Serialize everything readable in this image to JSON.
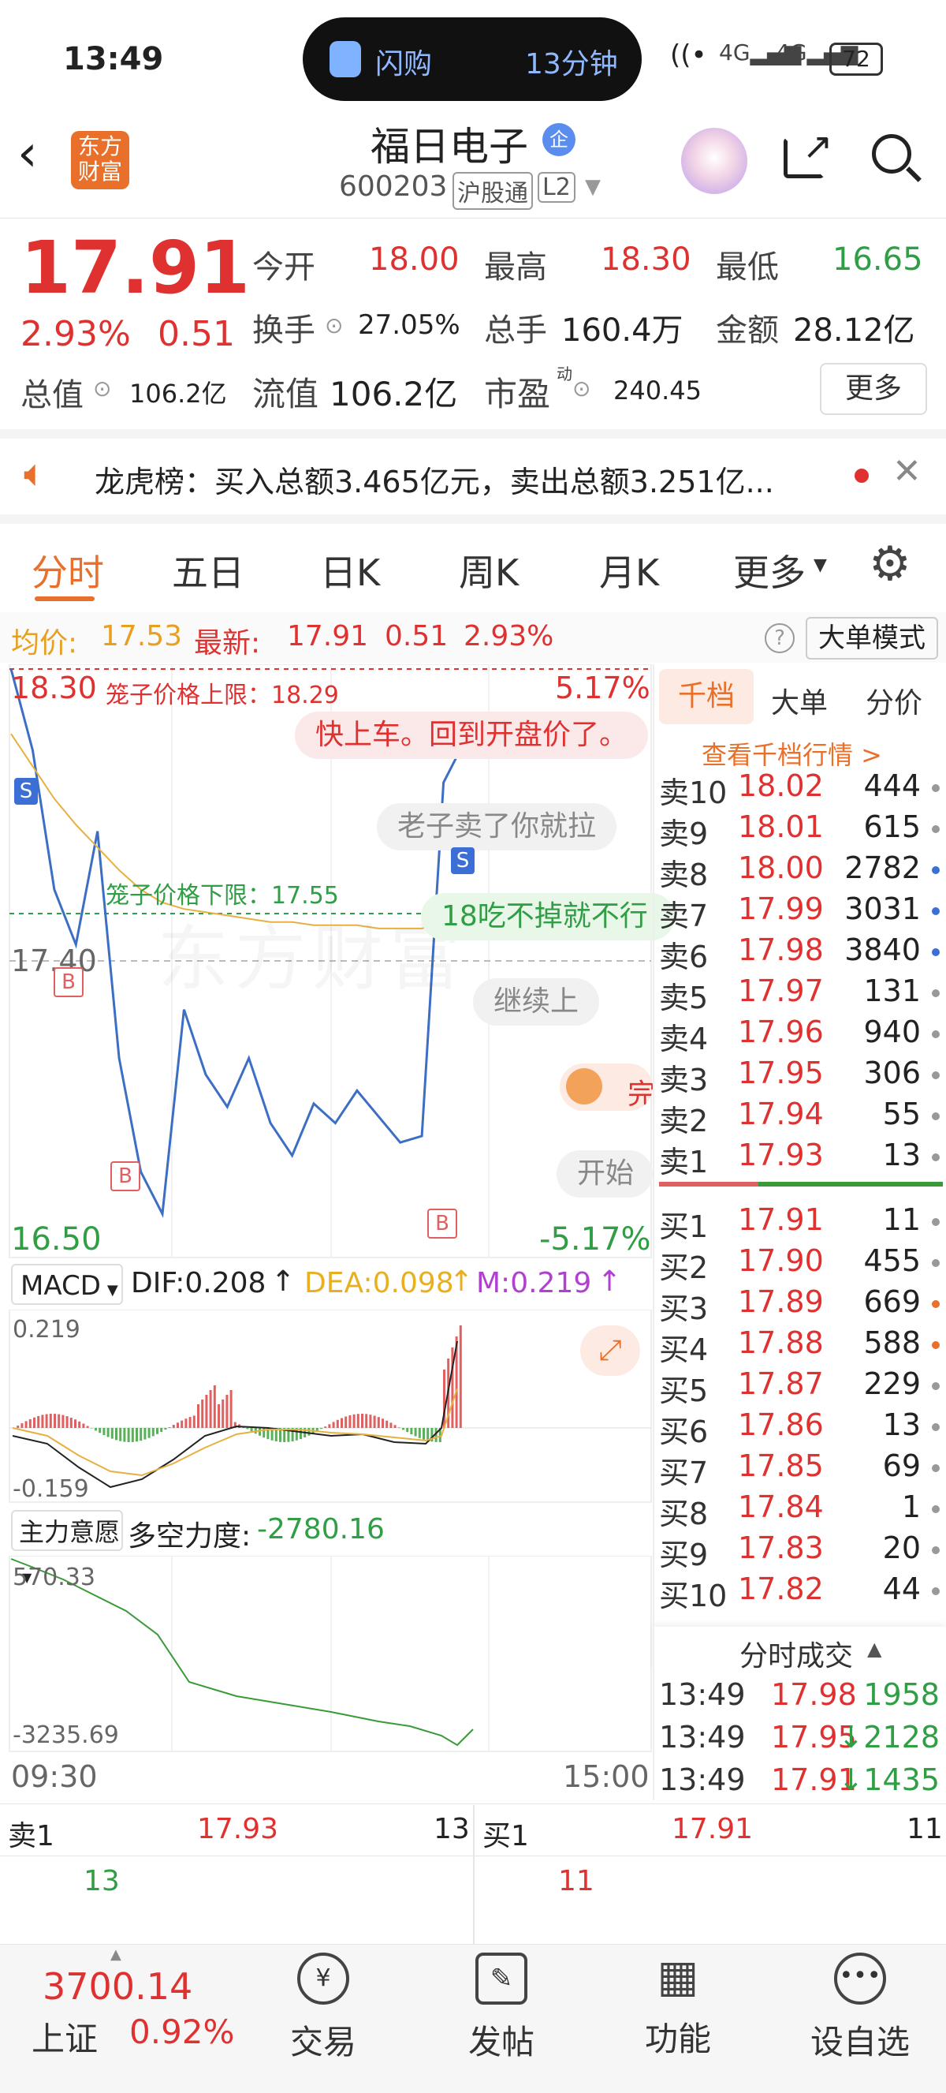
{
  "status_bar": {
    "time": "13:49",
    "pill_app": "闪购",
    "pill_time": "13分钟",
    "battery": "72"
  },
  "header": {
    "back": "<",
    "logo_line1": "东方",
    "logo_line2": "财富",
    "title": "福日电子",
    "title_badge": "企",
    "code": "600203",
    "tag1": "沪股通",
    "tag2": "L2"
  },
  "quote": {
    "price": "17.91",
    "pct": "2.93%",
    "change": "0.51",
    "open_label": "今开",
    "open": "18.00",
    "high_label": "最高",
    "high": "18.30",
    "low_label": "最低",
    "low": "16.65",
    "turnover_label": "换手",
    "turnover": "27.05%",
    "volume_label": "总手",
    "volume": "160.4万",
    "amount_label": "金额",
    "amount": "28.12亿",
    "mktcap_label": "总值",
    "mktcap": "106.2亿",
    "float_label": "流值",
    "float": "106.2亿",
    "pe_label": "市盈",
    "pe_sup": "动",
    "pe": "240.45",
    "more_btn": "更多"
  },
  "news": {
    "text": "龙虎榜：买入总额3.465亿元，卖出总额3.251亿..."
  },
  "tabs": [
    "分时",
    "五日",
    "日K",
    "周K",
    "月K",
    "更多"
  ],
  "info_line": {
    "avg_label": "均价:",
    "avg": "17.53",
    "latest_label": "最新:",
    "latest": "17.91",
    "chg": "0.51",
    "pct": "2.93%",
    "mode_btn": "大单模式"
  },
  "chart": {
    "y_top": "18.30",
    "y_mid": "17.40",
    "y_bot": "16.50",
    "pct_top": "5.17%",
    "pct_bot": "-5.17%",
    "cage_upper": "笼子价格上限：18.29",
    "cage_lower": "笼子价格下限：17.55",
    "danmaku": [
      "快上车。回到开盘价了。",
      "老子卖了你就拉",
      "18吃不掉就不行",
      "继续上",
      "完",
      "开始"
    ],
    "time_start": "09:30",
    "time_end": "15:00",
    "markers": [
      "S",
      "B",
      "B",
      "S",
      "B"
    ]
  },
  "chart_data": {
    "type": "line",
    "title": "",
    "x": [
      "09:30",
      "15:00"
    ],
    "series": [
      {
        "values": [
          18.3,
          18.05,
          17.62,
          17.45,
          17.8,
          17.1,
          16.75,
          16.62,
          17.25,
          17.05,
          16.95,
          17.1,
          16.9,
          16.8,
          16.96,
          16.9,
          17.0,
          16.92,
          16.84,
          16.86,
          17.95,
          18.08
        ]
      },
      {
        "values": [
          18.1,
          18.0,
          17.9,
          17.82,
          17.75,
          17.68,
          17.62,
          17.58,
          17.56,
          17.55,
          17.54,
          17.53,
          17.52,
          17.52,
          17.51,
          17.51,
          17.51,
          17.5,
          17.5,
          17.5,
          17.52,
          17.53
        ]
      }
    ],
    "ylim": [
      16.5,
      18.3
    ]
  },
  "macd": {
    "label": "MACD",
    "dif": "DIF:0.208",
    "dea": "DEA:0.098",
    "m": "M:0.219",
    "top": "0.219",
    "bot": "-0.159"
  },
  "zlyy": {
    "label": "主力意愿",
    "dk_label": "多空力度:",
    "dk": "-2780.16",
    "top": "570.33",
    "bot": "-3235.69"
  },
  "orderbook": {
    "tabs": [
      "千档",
      "大单",
      "分价"
    ],
    "link": "查看千档行情 >",
    "asks": [
      {
        "label": "卖10",
        "price": "18.02",
        "qty": "444",
        "dot": "#999"
      },
      {
        "label": "卖9",
        "price": "18.01",
        "qty": "615",
        "dot": "#999"
      },
      {
        "label": "卖8",
        "price": "18.00",
        "qty": "2782",
        "dot": "#3b6fd6"
      },
      {
        "label": "卖7",
        "price": "17.99",
        "qty": "3031",
        "dot": "#3b6fd6"
      },
      {
        "label": "卖6",
        "price": "17.98",
        "qty": "3840",
        "dot": "#3b6fd6"
      },
      {
        "label": "卖5",
        "price": "17.97",
        "qty": "131",
        "dot": "#999"
      },
      {
        "label": "卖4",
        "price": "17.96",
        "qty": "940",
        "dot": "#999"
      },
      {
        "label": "卖3",
        "price": "17.95",
        "qty": "306",
        "dot": "#999"
      },
      {
        "label": "卖2",
        "price": "17.94",
        "qty": "55",
        "dot": "#999"
      },
      {
        "label": "卖1",
        "price": "17.93",
        "qty": "13",
        "dot": "#999"
      }
    ],
    "bids": [
      {
        "label": "买1",
        "price": "17.91",
        "qty": "11",
        "dot": "#999"
      },
      {
        "label": "买2",
        "price": "17.90",
        "qty": "455",
        "dot": "#999"
      },
      {
        "label": "买3",
        "price": "17.89",
        "qty": "669",
        "dot": "#e8702a"
      },
      {
        "label": "买4",
        "price": "17.88",
        "qty": "588",
        "dot": "#e8702a"
      },
      {
        "label": "买5",
        "price": "17.87",
        "qty": "229",
        "dot": "#999"
      },
      {
        "label": "买6",
        "price": "17.86",
        "qty": "13",
        "dot": "#999"
      },
      {
        "label": "买7",
        "price": "17.85",
        "qty": "69",
        "dot": "#999"
      },
      {
        "label": "买8",
        "price": "17.84",
        "qty": "1",
        "dot": "#999"
      },
      {
        "label": "买9",
        "price": "17.83",
        "qty": "20",
        "dot": "#999"
      },
      {
        "label": "买10",
        "price": "17.82",
        "qty": "44",
        "dot": "#999"
      }
    ],
    "ticks_title": "分时成交",
    "ticks": [
      {
        "time": "13:49",
        "price": "17.98",
        "qty": "1958",
        "arrow": ""
      },
      {
        "time": "13:49",
        "price": "17.95",
        "qty": "2128",
        "arrow": "↓"
      },
      {
        "time": "13:49",
        "price": "17.91",
        "qty": "1435",
        "arrow": "↓"
      }
    ]
  },
  "summary": {
    "sell_label": "卖1",
    "sell_price": "17.93",
    "sell_qty": "13",
    "sell_sub": "13",
    "buy_label": "买1",
    "buy_price": "17.91",
    "buy_qty": "11",
    "buy_sub": "11"
  },
  "bottom": {
    "index_value": "3700.14",
    "index_name": "上证",
    "index_pct": "0.92%",
    "items": [
      "交易",
      "发帖",
      "功能",
      "设自选"
    ]
  },
  "colors": {
    "red": "#e03131",
    "green": "#2f9e44",
    "accent": "#e8702a"
  }
}
